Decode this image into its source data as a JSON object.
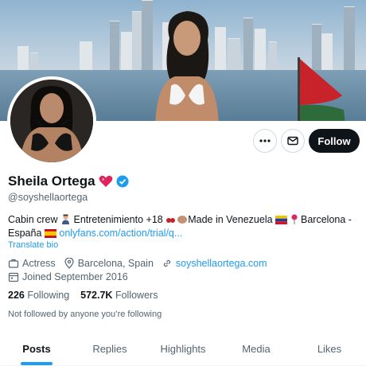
{
  "profile": {
    "display_name": "Sheila Ortega",
    "handle": "@soyshellaortega",
    "bio_text_1": "Cabin crew",
    "bio_text_2": "Entretenimiento +18",
    "bio_text_3": "Made in Venezuela",
    "bio_text_4": "Barcelona -",
    "bio_text_5": "España",
    "bio_link": "onlyfans.com/action/trial/q...",
    "translate_label": "Translate bio",
    "profession": "Actress",
    "location": "Barcelona, Spain",
    "website": "soyshellaortega.com",
    "joined": "Joined September 2016",
    "following_count": "226",
    "following_label": "Following",
    "followers_count": "572.7K",
    "followers_label": "Followers",
    "not_followed_text": "Not followed by anyone you’re following"
  },
  "actions": {
    "follow_label": "Follow",
    "more_icon": "more-horizontal-icon",
    "message_icon": "envelope-icon"
  },
  "tabs": [
    {
      "label": "Posts",
      "active": true
    },
    {
      "label": "Replies",
      "active": false
    },
    {
      "label": "Highlights",
      "active": false
    },
    {
      "label": "Media",
      "active": false
    },
    {
      "label": "Likes",
      "active": false
    }
  ],
  "colors": {
    "accent": "#1d9bf0",
    "text": "#0f1419",
    "muted": "#536471",
    "follow_button": "#0f1419"
  }
}
